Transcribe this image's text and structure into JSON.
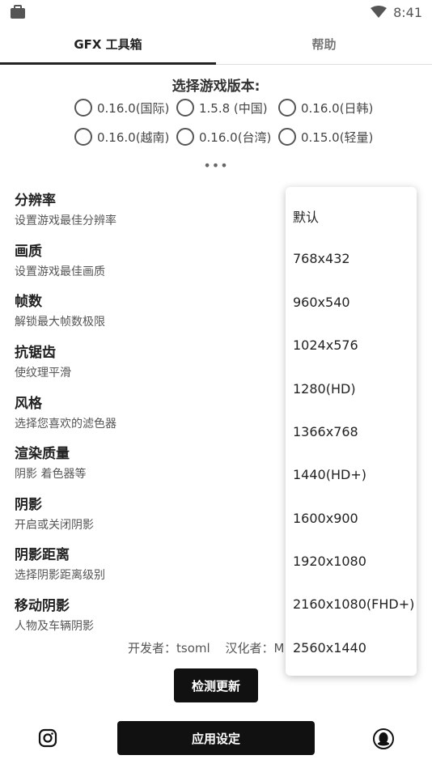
{
  "status_bar": {
    "time": "8:41"
  },
  "tabs": [
    {
      "label": "GFX 工具箱",
      "active": true
    },
    {
      "label": "帮助",
      "active": false
    }
  ],
  "version": {
    "title": "选择游戏版本:",
    "options": [
      "0.16.0(国际)",
      "1.5.8 (中国)",
      "0.16.0(日韩)",
      "0.16.0(越南)",
      "0.16.0(台湾)",
      "0.15.0(轻量)"
    ],
    "more": "•••"
  },
  "settings": [
    {
      "title": "分辨率",
      "desc": "设置游戏最佳分辨率"
    },
    {
      "title": "画质",
      "desc": "设置游戏最佳画质"
    },
    {
      "title": "帧数",
      "desc": "解锁最大帧数极限"
    },
    {
      "title": "抗锯齿",
      "desc": "使纹理平滑"
    },
    {
      "title": "风格",
      "desc": "选择您喜欢的滤色器"
    },
    {
      "title": "渲染质量",
      "desc": "阴影 着色器等"
    },
    {
      "title": "阴影",
      "desc": "开启或关闭阴影"
    },
    {
      "title": "阴影距离",
      "desc": "选择阴影距离级别"
    },
    {
      "title": "移动阴影",
      "desc": "人物及车辆阴影"
    }
  ],
  "credits": {
    "developer": "开发者：tsoml",
    "translator": "汉化者：M"
  },
  "check_update_label": "检测更新",
  "apply_label": "应用设定",
  "resolution_dropdown": {
    "options": [
      "默认",
      "768x432",
      "960x540",
      "1024x576",
      "1280(HD)",
      "1366x768",
      "1440(HD+)",
      "1600x900",
      "1920x1080",
      "2160x1080(FHD+)",
      "2560x1440"
    ]
  }
}
